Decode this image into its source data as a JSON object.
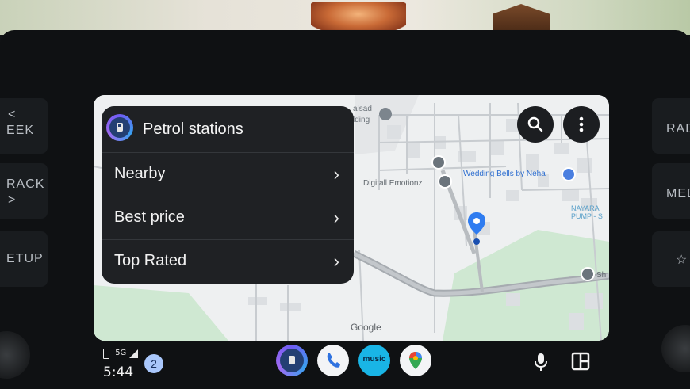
{
  "panel": {
    "title": "Petrol stations",
    "items": [
      {
        "label": "Nearby"
      },
      {
        "label": "Best price"
      },
      {
        "label": "Top Rated"
      }
    ]
  },
  "map": {
    "labels": {
      "top_left_a": "alsad",
      "top_left_b": "lding",
      "poi_1": "Digitall Emotionz",
      "poi_2": "Wedding Bells by Neha",
      "poi_3a": "NAYARA",
      "poi_3b": "PUMP - S",
      "poi_4": "Sh"
    },
    "attribution": "Google"
  },
  "status": {
    "network": "5G",
    "time": "5:44",
    "notification_count": "2"
  },
  "bezel": {
    "left_buttons": [
      "EEK",
      "RACK",
      "ETUP"
    ],
    "right_buttons": [
      "RAD",
      "MED",
      "☆"
    ]
  },
  "dock": {
    "apps": [
      "fuel-app",
      "phone",
      "music",
      "maps"
    ],
    "music_label": "music"
  },
  "colors": {
    "panel_bg": "#1f2124",
    "map_bg": "#eef0f1",
    "park_green": "#cfe8d2",
    "pin_blue": "#2f7cf0",
    "notif_bg": "#a9c7fb"
  }
}
